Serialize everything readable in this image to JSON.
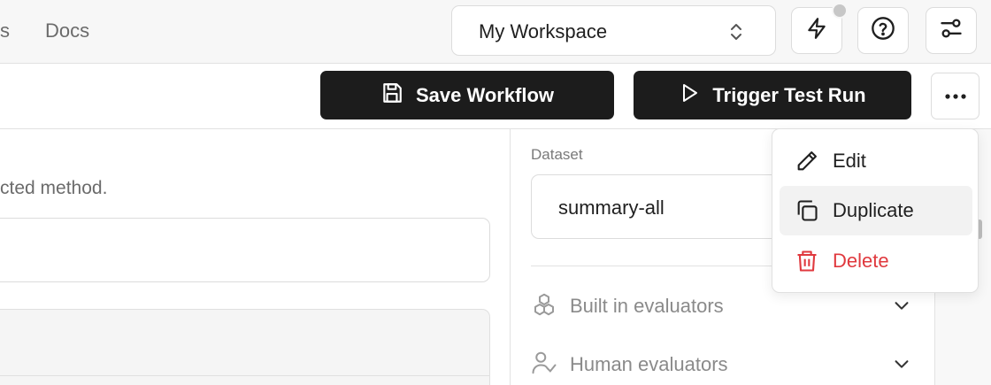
{
  "topbar": {
    "nav_partial": "s",
    "nav_docs": "Docs",
    "workspace_label": "My Workspace",
    "icons": [
      "bolt-icon",
      "help-icon",
      "settings-sliders-icon"
    ]
  },
  "toolbar": {
    "save_label": "Save Workflow",
    "run_label": "Trigger Test Run"
  },
  "main": {
    "helper_text": "cted method."
  },
  "panel": {
    "dataset_label": "Dataset",
    "dataset_value": "summary-all",
    "sections": [
      {
        "label": "Built in evaluators",
        "icon": "boxes-icon"
      },
      {
        "label": "Human evaluators",
        "icon": "user-check-icon"
      }
    ]
  },
  "menu": {
    "items": [
      {
        "label": "Edit",
        "icon": "pencil-icon"
      },
      {
        "label": "Duplicate",
        "icon": "copy-icon"
      },
      {
        "label": "Delete",
        "icon": "trash-icon",
        "color": "#e0393e"
      }
    ]
  }
}
